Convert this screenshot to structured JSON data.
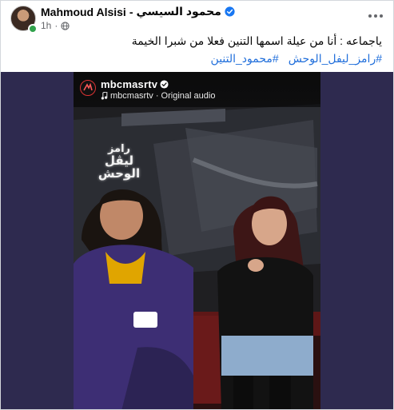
{
  "post": {
    "author_name": "Mahmoud Alsisi",
    "separator": "-",
    "author_name_ar": "محمود السيسي",
    "time": "1h",
    "caption": "ياجماعه : أنا من عيلة اسمها التنين فعلا من شبرا الخيمة",
    "hashtags": [
      "#محمود_التنين",
      "#رامز_ليفل_الوحش"
    ]
  },
  "video": {
    "channel_handle": "mbcmasrtv",
    "audio_sep": "·",
    "audio_label": "mbcmasrtv · Original audio",
    "show_logo_line1": "رامز",
    "show_logo_line2": "ليڤل الوحش"
  },
  "colors": {
    "link": "#216fdb",
    "verified": "#1877f2",
    "online": "#31a24c",
    "video_bg": "#2e2a4f"
  },
  "icons": [
    "verified-badge-icon",
    "globe-icon",
    "more-options-icon",
    "music-note-icon",
    "channel-logo-icon"
  ]
}
